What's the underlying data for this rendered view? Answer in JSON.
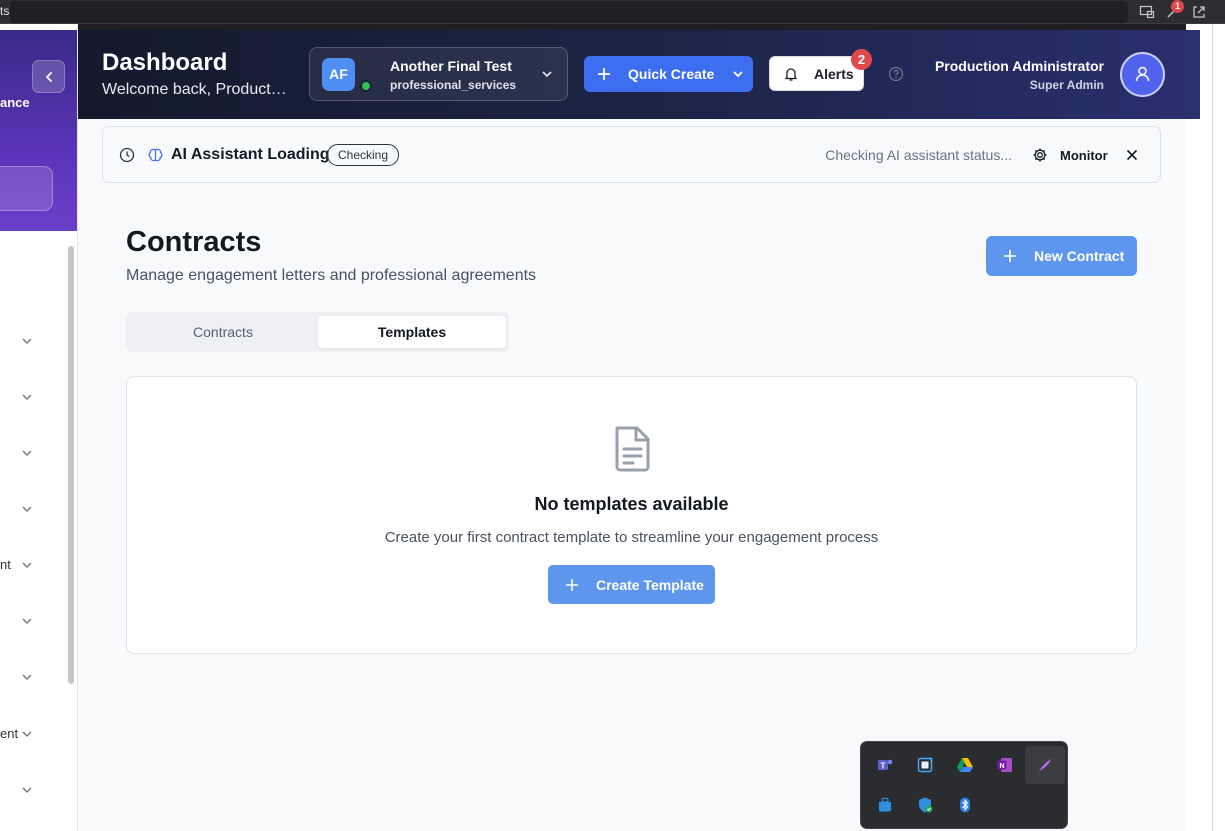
{
  "browser": {
    "tab_fragment": "ts",
    "extension_badge": "1"
  },
  "sidebar": {
    "brand_fragment": "ance",
    "items": [
      {
        "label": ""
      },
      {
        "label": ""
      },
      {
        "label": ""
      },
      {
        "label": ""
      },
      {
        "label": "nt"
      },
      {
        "label": ""
      },
      {
        "label": ""
      },
      {
        "label": "ent"
      },
      {
        "label": ""
      }
    ]
  },
  "header": {
    "title": "Dashboard",
    "subtitle": "Welcome back, Production Administrator",
    "org": {
      "initials": "AF",
      "name": "Another Final Test",
      "type": "professional_services"
    },
    "quick_create_label": "Quick Create",
    "alerts_label": "Alerts",
    "alerts_count": "2",
    "user_name": "Production Administrator",
    "user_role": "Super Admin"
  },
  "ai_bar": {
    "title": "AI Assistant Loading",
    "chip": "Checking",
    "status": "Checking AI assistant status...",
    "monitor_label": "Monitor"
  },
  "page": {
    "title": "Contracts",
    "subtitle": "Manage engagement letters and professional agreements",
    "new_button": "New Contract",
    "tabs": [
      {
        "label": "Contracts",
        "active": false
      },
      {
        "label": "Templates",
        "active": true
      }
    ],
    "empty": {
      "title": "No templates available",
      "description": "Create your first contract template to streamline your engagement process",
      "button": "Create Template"
    }
  },
  "tray": {
    "icons": [
      "teams-icon",
      "snipping-tool-icon",
      "google-drive-icon",
      "onenote-icon",
      "pen-icon",
      "windows-store-icon",
      "defender-icon",
      "bluetooth-icon"
    ]
  },
  "colors": {
    "primary": "#3d6ef0",
    "button_blue": "#5e96ee",
    "badge_red": "#e0484e",
    "online_green": "#2fbf58"
  }
}
